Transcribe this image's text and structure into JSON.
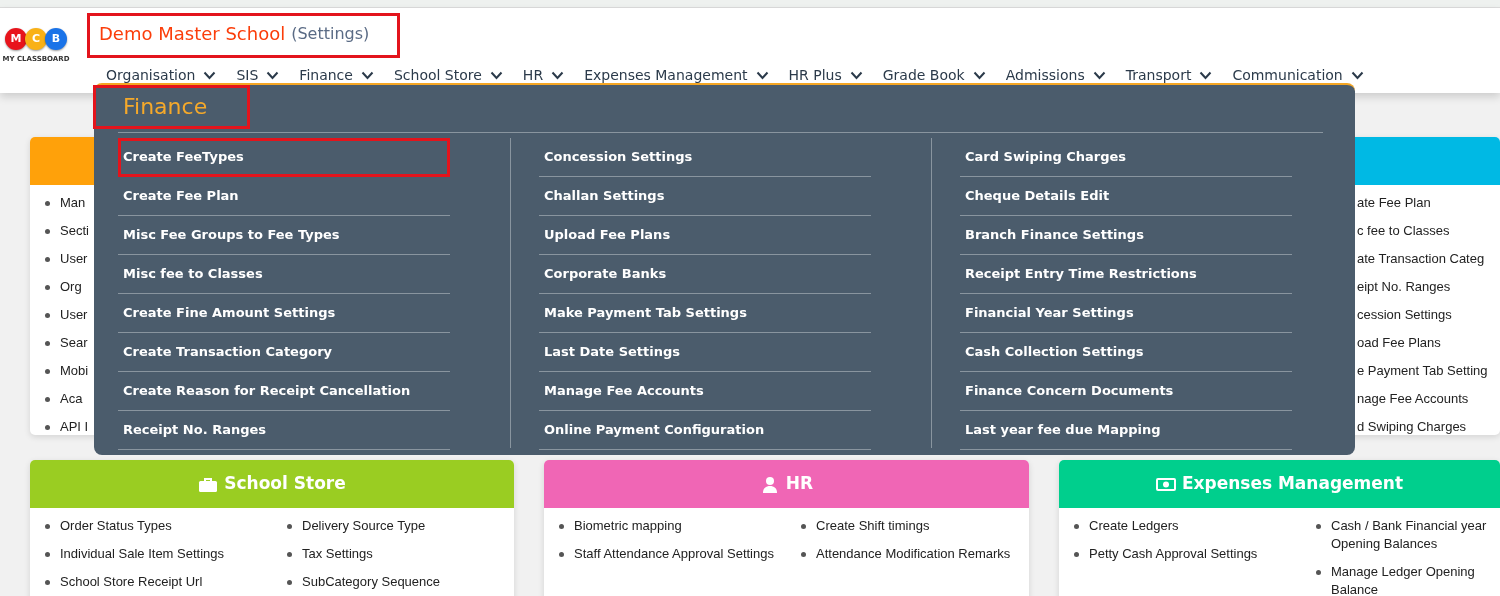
{
  "logo": {
    "letters": [
      {
        "text": "M",
        "color": "#e8141c"
      },
      {
        "text": "C",
        "color": "#f9b116"
      },
      {
        "text": "B",
        "color": "#1a73e8"
      }
    ],
    "caption": "MY CLASSBOARD"
  },
  "header": {
    "title": "Demo Master School",
    "subtitle": "(Settings)",
    "highlighted": true
  },
  "nav": [
    {
      "label": "Organisation"
    },
    {
      "label": "SIS"
    },
    {
      "label": "Finance"
    },
    {
      "label": "School Store"
    },
    {
      "label": "HR"
    },
    {
      "label": "Expenses Management"
    },
    {
      "label": "HR Plus"
    },
    {
      "label": "Grade Book"
    },
    {
      "label": "Admissions"
    },
    {
      "label": "Transport"
    },
    {
      "label": "Communication"
    }
  ],
  "menu": {
    "title": "Finance",
    "highlighted": true,
    "columns": [
      [
        {
          "label": "Create FeeTypes",
          "highlighted": true
        },
        {
          "label": "Create Fee Plan",
          "highlighted": false
        },
        {
          "label": "Misc Fee Groups to Fee Types",
          "highlighted": false
        },
        {
          "label": "Misc fee to Classes",
          "highlighted": false
        },
        {
          "label": "Create Fine Amount Settings",
          "highlighted": false
        },
        {
          "label": "Create Transaction Category",
          "highlighted": false
        },
        {
          "label": "Create Reason for Receipt Cancellation",
          "highlighted": false
        },
        {
          "label": "Receipt No. Ranges",
          "highlighted": false
        }
      ],
      [
        {
          "label": "Concession Settings",
          "highlighted": false
        },
        {
          "label": "Challan Settings",
          "highlighted": false
        },
        {
          "label": "Upload Fee Plans",
          "highlighted": false
        },
        {
          "label": "Corporate Banks",
          "highlighted": false
        },
        {
          "label": "Make Payment Tab Settings",
          "highlighted": false
        },
        {
          "label": "Last Date Settings",
          "highlighted": false
        },
        {
          "label": "Manage Fee Accounts",
          "highlighted": false
        },
        {
          "label": "Online Payment Configuration",
          "highlighted": false
        }
      ],
      [
        {
          "label": "Card Swiping Charges",
          "highlighted": false
        },
        {
          "label": "Cheque Details Edit",
          "highlighted": false
        },
        {
          "label": "Branch Finance Settings",
          "highlighted": false
        },
        {
          "label": "Receipt Entry Time Restrictions",
          "highlighted": false
        },
        {
          "label": "Financial Year Settings",
          "highlighted": false
        },
        {
          "label": "Cash Collection Settings",
          "highlighted": false
        },
        {
          "label": "Finance Concern Documents",
          "highlighted": false
        },
        {
          "label": "Last year fee due Mapping",
          "highlighted": false
        }
      ]
    ]
  },
  "top_cards": [
    {
      "color": "#ffa10a",
      "items": [
        "Man",
        "Secti",
        "User",
        "Org",
        "User",
        "Sear",
        "Mobi",
        "Aca",
        "API I"
      ]
    },
    {
      "color": "#00b9e4",
      "items": [
        "ate Fee Plan",
        "c fee to Classes",
        "ate Transaction Categ",
        "eipt No. Ranges",
        "cession Settings",
        "oad Fee Plans",
        "e Payment Tab Setting",
        "nage Fee Accounts",
        "d Swiping Charges"
      ]
    }
  ],
  "cards": [
    {
      "title": "School Store",
      "color": "#9acd22",
      "columns": [
        [
          "Order Status Types",
          "Individual Sale Item Settings",
          "School Store Receipt Url"
        ],
        [
          "Delivery Source Type",
          "Tax Settings",
          "SubCategory Sequence"
        ]
      ]
    },
    {
      "title": "HR",
      "color": "#f066b5",
      "columns": [
        [
          "Biometric mapping",
          "Staff Attendance Approval Settings"
        ],
        [
          "Create Shift timings",
          "Attendance Modification Remarks"
        ]
      ]
    },
    {
      "title": "Expenses Management",
      "color": "#00cf8d",
      "columns": [
        [
          "Create Ledgers",
          "Petty Cash Approval Settings"
        ],
        [
          "Cash / Bank Financial year Opening Balances",
          "Manage Ledger Opening Balance"
        ]
      ]
    }
  ]
}
